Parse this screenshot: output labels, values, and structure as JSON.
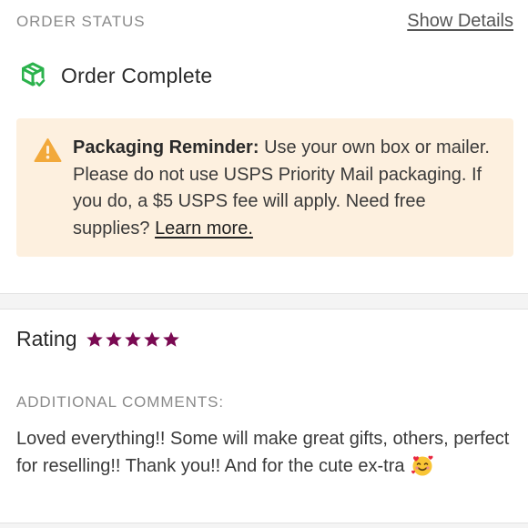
{
  "order_status": {
    "section_label": "ORDER STATUS",
    "show_details_label": "Show Details",
    "status_icon": "package-check-icon",
    "status_title": "Order Complete",
    "status_icon_color": "#2bb24c"
  },
  "reminder": {
    "icon": "warning-triangle-icon",
    "icon_color": "#f2a93b",
    "background": "#fdf0df",
    "heading": "Packaging Reminder:",
    "body": " Use your own box or mailer. Please do not use USPS Priority Mail packaging. If you do, a $5 USPS fee will apply. Need free supplies? ",
    "link_label": "Learn more."
  },
  "rating": {
    "title": "Rating",
    "stars": 5,
    "max_stars": 5,
    "star_color": "#7a0a52",
    "comments_label": "ADDITIONAL COMMENTS:",
    "comment": "Loved everything!! Some will make great gifts, others, perfect for reselling!! Thank you!! And for the cute ex-tra",
    "comment_emoji": "smiling-face-with-hearts-icon"
  }
}
